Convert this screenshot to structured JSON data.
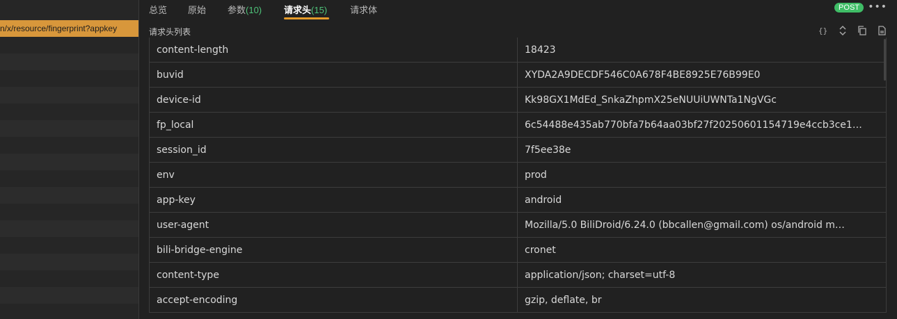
{
  "left_list": {
    "selected_url": "n/x/resource/fingerprint?appkey"
  },
  "tabs": [
    {
      "label": "总览",
      "count": ""
    },
    {
      "label": "原始",
      "count": ""
    },
    {
      "label": "参数",
      "count": "(10)"
    },
    {
      "label": "请求头",
      "count": "(15)"
    },
    {
      "label": "请求体",
      "count": ""
    }
  ],
  "active_tab": "请求头",
  "method": "POST",
  "section_title": "请求头列表",
  "toolbar": {
    "icons": [
      "braces-icon",
      "collapse-expand-icon",
      "copy-icon",
      "file-icon"
    ]
  },
  "headers": [
    {
      "name": "content-length",
      "value": "18423"
    },
    {
      "name": "buvid",
      "value": "XYDA2A9DECDF546C0A678F4BE8925E76B99E0"
    },
    {
      "name": "device-id",
      "value": "Kk98GX1MdEd_SnkaZhpmX25eNUUiUWNTa1NgVGc"
    },
    {
      "name": "fp_local",
      "value": "6c54488e435ab770bfa7b64aa03bf27f20250601154719e4ccb3ce1…"
    },
    {
      "name": "session_id",
      "value": "7f5ee38e"
    },
    {
      "name": "env",
      "value": "prod"
    },
    {
      "name": "app-key",
      "value": "android"
    },
    {
      "name": "user-agent",
      "value": "Mozilla/5.0 BiliDroid/6.24.0 (bbcallen@gmail.com) os/android m…"
    },
    {
      "name": "bili-bridge-engine",
      "value": "cronet"
    },
    {
      "name": "content-type",
      "value": "application/json; charset=utf-8"
    },
    {
      "name": "accept-encoding",
      "value": "gzip, deflate, br"
    }
  ]
}
